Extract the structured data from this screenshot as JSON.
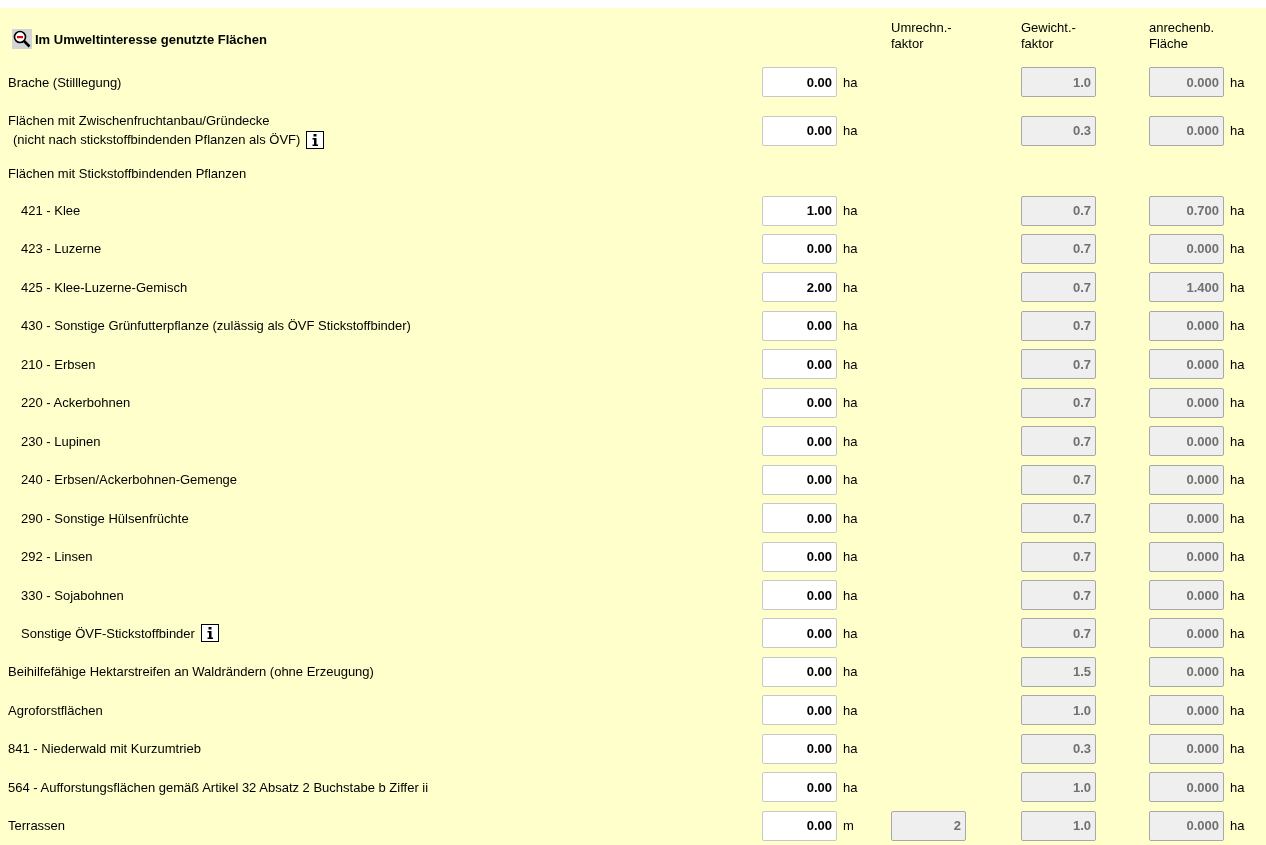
{
  "section": {
    "title": "Im Umweltinteresse genutzte Flächen",
    "columns": [
      {
        "kind": "conversion",
        "label": "Umrechn.-",
        "label_line2": "faktor"
      },
      {
        "kind": "weight",
        "label": "Gewicht.-",
        "label_line2": "faktor"
      },
      {
        "kind": "area",
        "label": "anrechenb.",
        "label_line2": "Fläche"
      }
    ]
  },
  "rows": [
    {
      "kind": "entry",
      "label": "Brache (Stilllegung)",
      "value": "0.00",
      "unit": "ha",
      "weight": "1.0",
      "area": "0.000",
      "area_unit": "ha"
    },
    {
      "kind": "entry",
      "label": "Flächen mit Zwischenfruchtanbau/Gründecke",
      "label_line2": "(nicht nach stickstoffbindenden Pflanzen als ÖVF)",
      "info": true,
      "value": "0.00",
      "unit": "ha",
      "weight": "0.3",
      "area": "0.000",
      "area_unit": "ha"
    },
    {
      "kind": "heading",
      "label": "Flächen mit Stickstoffbindenden Pflanzen",
      "children": [
        {
          "kind": "entry",
          "label": "421 - Klee",
          "value": "1.00",
          "unit": "ha",
          "weight": "0.7",
          "area": "0.700",
          "area_unit": "ha"
        },
        {
          "kind": "entry",
          "label": "423 - Luzerne",
          "value": "0.00",
          "unit": "ha",
          "weight": "0.7",
          "area": "0.000",
          "area_unit": "ha"
        },
        {
          "kind": "entry",
          "label": "425 - Klee-Luzerne-Gemisch",
          "value": "2.00",
          "unit": "ha",
          "weight": "0.7",
          "area": "1.400",
          "area_unit": "ha"
        },
        {
          "kind": "entry",
          "label": "430 - Sonstige Grünfutterpflanze (zulässig als ÖVF Stickstoffbinder)",
          "value": "0.00",
          "unit": "ha",
          "weight": "0.7",
          "area": "0.000",
          "area_unit": "ha"
        },
        {
          "kind": "entry",
          "label": "210 - Erbsen",
          "value": "0.00",
          "unit": "ha",
          "weight": "0.7",
          "area": "0.000",
          "area_unit": "ha"
        },
        {
          "kind": "entry",
          "label": "220 - Ackerbohnen",
          "value": "0.00",
          "unit": "ha",
          "weight": "0.7",
          "area": "0.000",
          "area_unit": "ha"
        },
        {
          "kind": "entry",
          "label": "230 - Lupinen",
          "value": "0.00",
          "unit": "ha",
          "weight": "0.7",
          "area": "0.000",
          "area_unit": "ha"
        },
        {
          "kind": "entry",
          "label": "240 - Erbsen/Ackerbohnen-Gemenge",
          "value": "0.00",
          "unit": "ha",
          "weight": "0.7",
          "area": "0.000",
          "area_unit": "ha"
        },
        {
          "kind": "entry",
          "label": "290 - Sonstige Hülsenfrüchte",
          "value": "0.00",
          "unit": "ha",
          "weight": "0.7",
          "area": "0.000",
          "area_unit": "ha"
        },
        {
          "kind": "entry",
          "label": "292 - Linsen",
          "value": "0.00",
          "unit": "ha",
          "weight": "0.7",
          "area": "0.000",
          "area_unit": "ha"
        },
        {
          "kind": "entry",
          "label": "330 - Sojabohnen",
          "value": "0.00",
          "unit": "ha",
          "weight": "0.7",
          "area": "0.000",
          "area_unit": "ha"
        },
        {
          "kind": "entry",
          "label": "Sonstige ÖVF-Stickstoffbinder",
          "info": true,
          "value": "0.00",
          "unit": "ha",
          "weight": "0.7",
          "area": "0.000",
          "area_unit": "ha"
        }
      ]
    },
    {
      "kind": "entry",
      "label": "Beihilfefähige Hektarstreifen an Waldrändern (ohne Erzeugung)",
      "value": "0.00",
      "unit": "ha",
      "weight": "1.5",
      "area": "0.000",
      "area_unit": "ha"
    },
    {
      "kind": "entry",
      "label": "Agroforstflächen",
      "value": "0.00",
      "unit": "ha",
      "weight": "1.0",
      "area": "0.000",
      "area_unit": "ha"
    },
    {
      "kind": "entry",
      "label": "841 - Niederwald mit Kurzumtrieb",
      "value": "0.00",
      "unit": "ha",
      "weight": "0.3",
      "area": "0.000",
      "area_unit": "ha"
    },
    {
      "kind": "entry",
      "label": "564 - Aufforstungsflächen gemäß Artikel 32 Absatz 2 Buchstabe b Ziffer ii",
      "value": "0.00",
      "unit": "ha",
      "weight": "1.0",
      "area": "0.000",
      "area_unit": "ha"
    },
    {
      "kind": "entry",
      "label": "Terrassen",
      "value": "0.00",
      "unit": "m",
      "conversion": "2",
      "weight": "1.0",
      "area": "0.000",
      "area_unit": "ha"
    }
  ]
}
